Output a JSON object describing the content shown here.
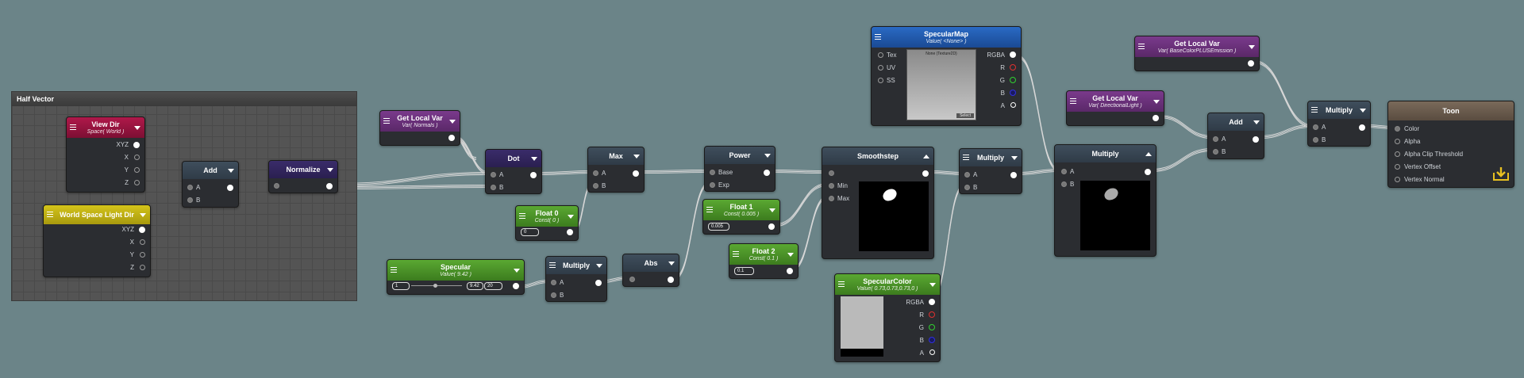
{
  "colors": {
    "background": "#6b8488",
    "wire": "#d8d8d8"
  },
  "group": {
    "title": "Half Vector"
  },
  "nodes": {
    "view_dir": {
      "title": "View Dir",
      "sub": "Space( World )",
      "outputs": [
        "XYZ",
        "X",
        "Y",
        "Z"
      ]
    },
    "world_light": {
      "title": "World Space Light Dir",
      "outputs": [
        "XYZ",
        "X",
        "Y",
        "Z"
      ]
    },
    "add1": {
      "title": "Add",
      "inputs": [
        "A",
        "B"
      ]
    },
    "normalize": {
      "title": "Normalize"
    },
    "get_normals": {
      "title": "Get Local Var",
      "sub": "Var( Normals )"
    },
    "dot": {
      "title": "Dot",
      "inputs": [
        "A",
        "B"
      ]
    },
    "float0": {
      "title": "Float 0",
      "sub": "Const( 0 )",
      "value": "0"
    },
    "max": {
      "title": "Max",
      "inputs": [
        "A",
        "B"
      ]
    },
    "specular": {
      "title": "Specular",
      "sub": "Value( 9.42 )",
      "min": "1",
      "value": "9.42",
      "max": "20"
    },
    "multiply1": {
      "title": "Multiply",
      "inputs": [
        "A",
        "B"
      ]
    },
    "abs": {
      "title": "Abs"
    },
    "power": {
      "title": "Power",
      "inputs": [
        "Base",
        "Exp"
      ]
    },
    "float1": {
      "title": "Float 1",
      "sub": "Const( 0.005 )",
      "value": "0.005"
    },
    "float2": {
      "title": "Float 2",
      "sub": "Const( 0.1 )",
      "value": "0.1"
    },
    "smoothstep": {
      "title": "Smoothstep",
      "inputs": [
        "",
        "Min",
        "Max"
      ]
    },
    "specular_map": {
      "title": "SpecularMap",
      "sub": "Value( <None> )",
      "inputs": [
        "Tex",
        "UV",
        "SS"
      ],
      "outputs": [
        "RGBA",
        "R",
        "G",
        "B",
        "A"
      ],
      "tex_label": "None (Texture2D)",
      "select": "Select"
    },
    "specular_color": {
      "title": "SpecularColor",
      "sub": "Value( 0.73,0.73,0.73,0 )",
      "outputs": [
        "RGBA",
        "R",
        "G",
        "B",
        "A"
      ]
    },
    "multiply2": {
      "title": "Multiply",
      "inputs": [
        "A",
        "B"
      ]
    },
    "multiply3": {
      "title": "Multiply",
      "inputs": [
        "A",
        "B"
      ]
    },
    "get_dirlight": {
      "title": "Get Local Var",
      "sub": "Var( DirectionalLight )"
    },
    "get_basecolor": {
      "title": "Get Local Var",
      "sub": "Var( BaseColorPLUSEmission )"
    },
    "add2": {
      "title": "Add",
      "inputs": [
        "A",
        "B"
      ]
    },
    "multiply4": {
      "title": "Multiply",
      "inputs": [
        "A",
        "B"
      ]
    },
    "toon": {
      "title": "Toon",
      "inputs": [
        "Color",
        "Alpha",
        "Alpha Clip Threshold",
        "Vertex Offset",
        "Vertex Normal"
      ]
    }
  }
}
